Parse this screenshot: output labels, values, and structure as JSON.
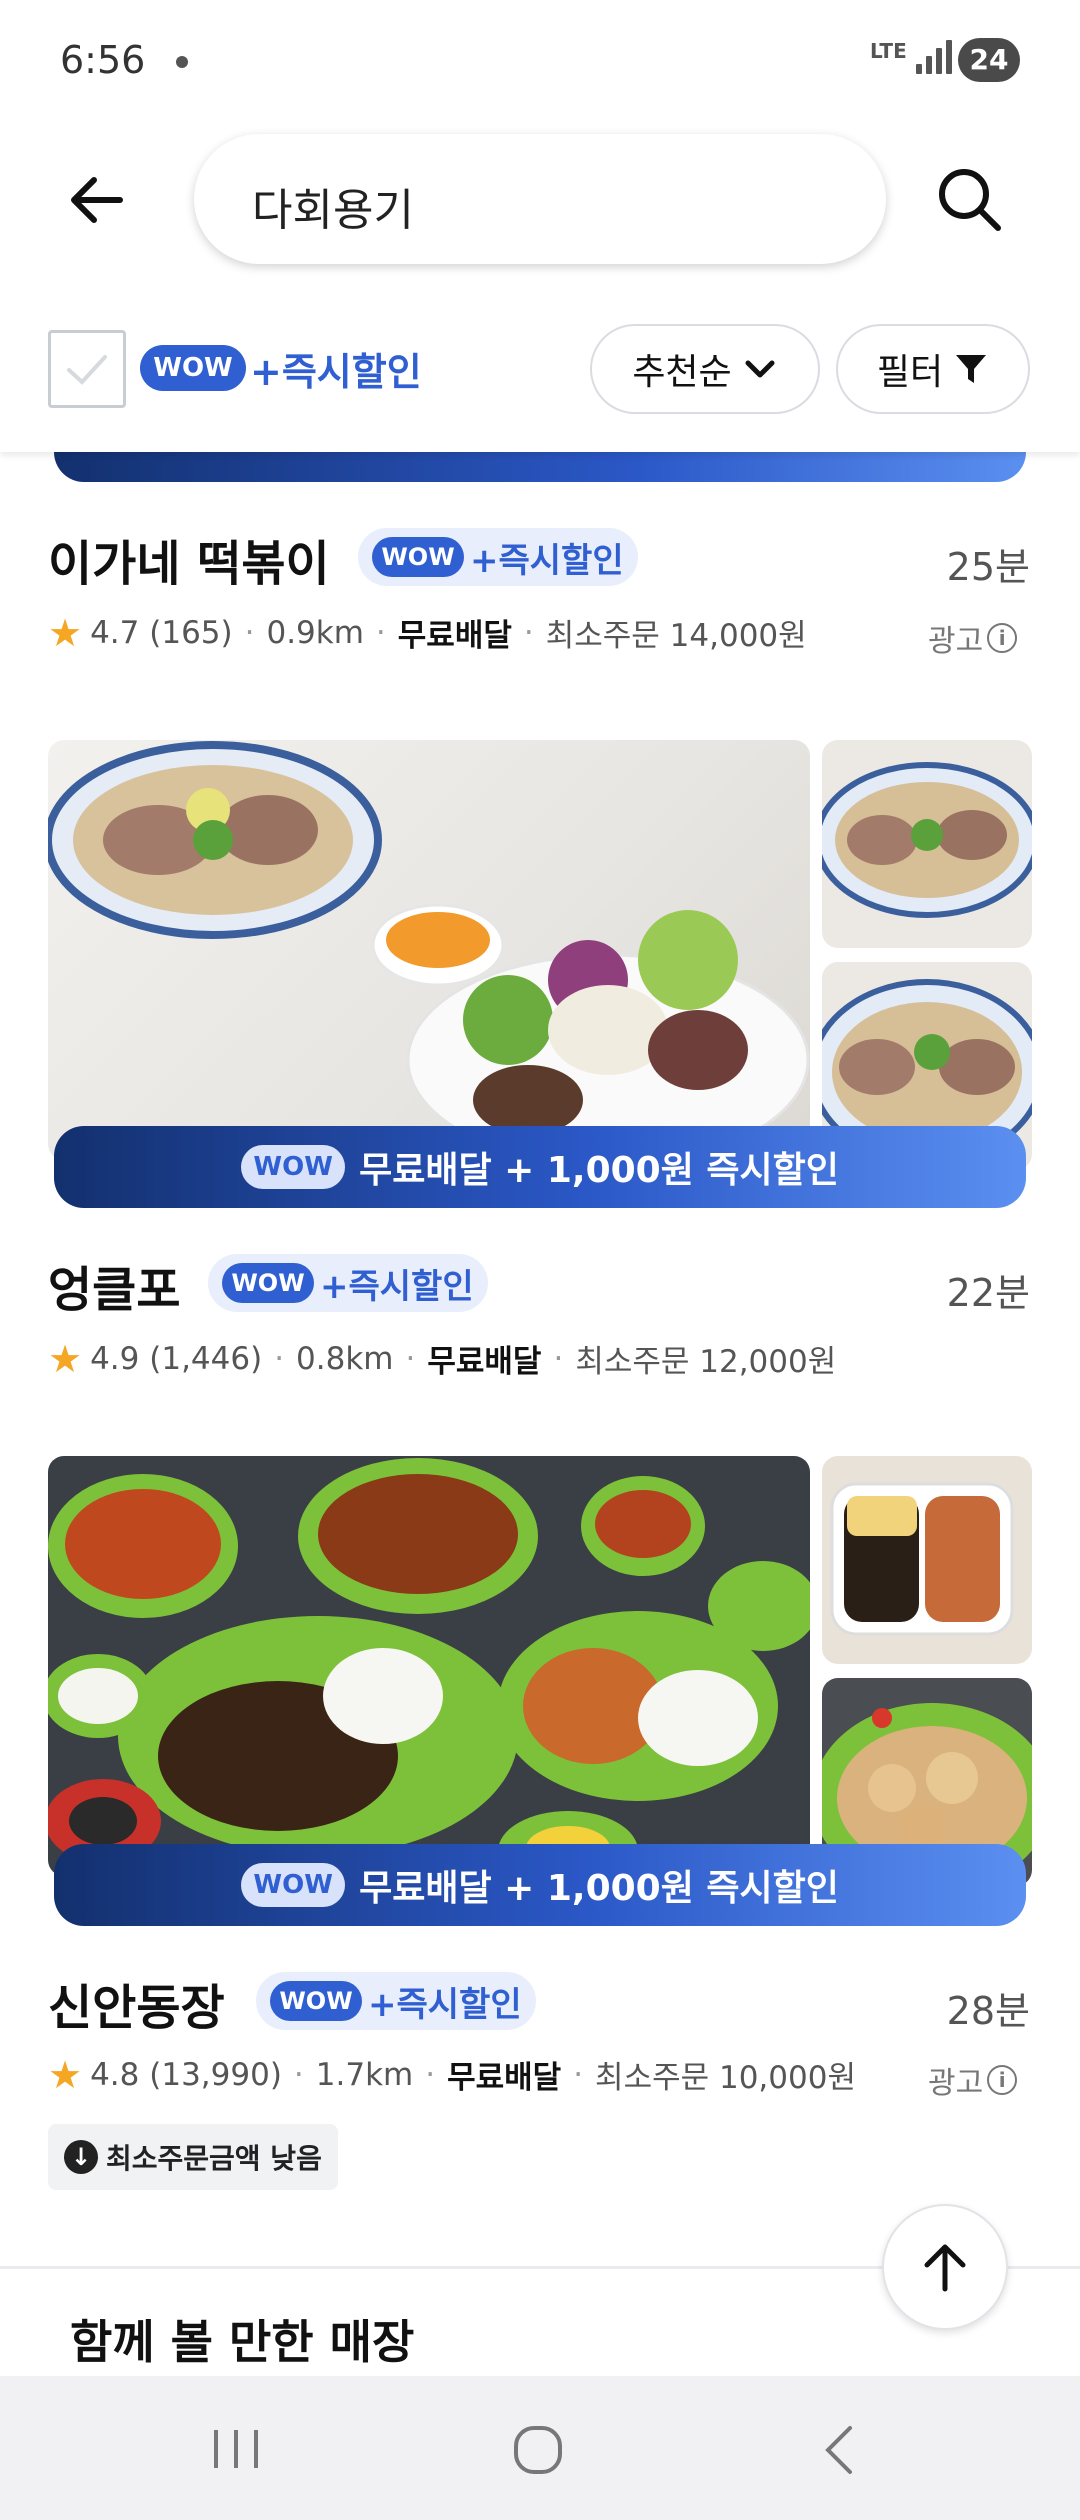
{
  "status_bar": {
    "time": "6:56",
    "network": "LTE",
    "battery": "24"
  },
  "search": {
    "query": "다회용기"
  },
  "filters": {
    "wow_label": "WOW",
    "instant_discount": "+즉시할인",
    "sort_label": "추천순",
    "filter_label": "필터"
  },
  "stores": [
    {
      "name": "이가네 떡볶이",
      "wow": "WOW",
      "tag": "+즉시할인",
      "eta": "25분",
      "rating": "4.7",
      "reviews": "(165)",
      "distance": "0.9km",
      "delivery": "무료배달",
      "min_order": "최소주문 14,000원",
      "ad": "광고"
    },
    {
      "name": "엉클포",
      "wow": "WOW",
      "tag": "+즉시할인",
      "eta": "22분",
      "rating": "4.9",
      "reviews": "(1,446)",
      "distance": "0.8km",
      "delivery": "무료배달",
      "min_order": "최소주문 12,000원",
      "banner": "무료배달 + 1,000원 즉시할인"
    },
    {
      "name": "신안동장",
      "wow": "WOW",
      "tag": "+즉시할인",
      "eta": "28분",
      "rating": "4.8",
      "reviews": "(13,990)",
      "distance": "1.7km",
      "delivery": "무료배달",
      "min_order": "최소주문 10,000원",
      "ad": "광고",
      "banner": "무료배달 + 1,000원 즉시할인",
      "badge": "최소주문금액 낮음"
    }
  ],
  "section": {
    "title": "함께 볼 만한 매장"
  },
  "colors": {
    "accent": "#2f5fd1",
    "banner_dark": "#13306e",
    "star": "#f5a623"
  }
}
